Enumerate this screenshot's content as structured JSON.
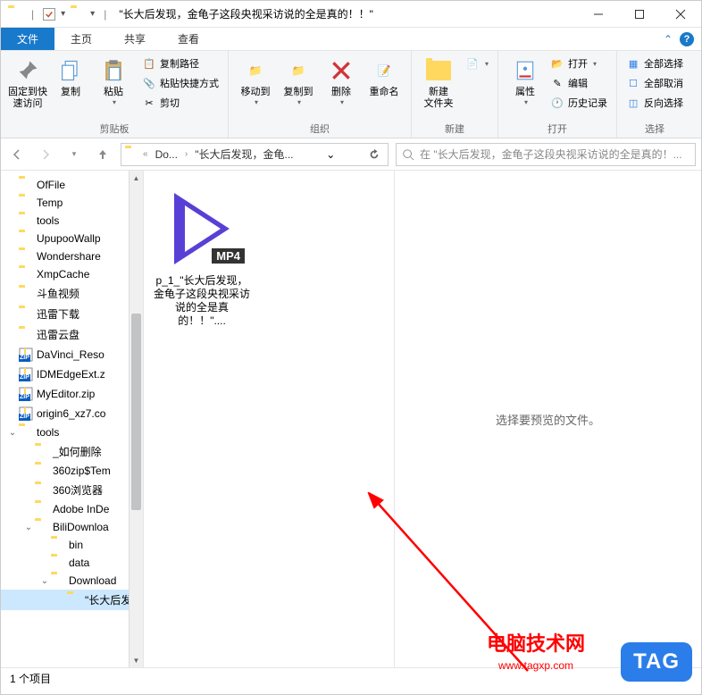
{
  "title": "\"长大后发现，金龟子这段央视采访说的全是真的！！\"",
  "tabs": {
    "file": "文件",
    "home": "主页",
    "share": "共享",
    "view": "查看"
  },
  "ribbon": {
    "pin": "固定到快\n速访问",
    "copy": "复制",
    "paste": "粘贴",
    "copyPath": "复制路径",
    "pasteShortcut": "粘贴快捷方式",
    "cut": "剪切",
    "clipboard": "剪贴板",
    "moveTo": "移动到",
    "copyTo": "复制到",
    "delete": "删除",
    "rename": "重命名",
    "organize": "组织",
    "newFolder": "新建\n文件夹",
    "new": "新建",
    "properties": "属性",
    "openBtn": "打开",
    "edit": "编辑",
    "history": "历史记录",
    "openGroup": "打开",
    "selectAll": "全部选择",
    "selectNone": "全部取消",
    "invertSel": "反向选择",
    "select": "选择"
  },
  "breadcrumb": {
    "seg1": "Do...",
    "seg2": "\"长大后发现，金龟..."
  },
  "search": "在 \"长大后发现，金龟子这段央视采访说的全是真的！...",
  "tree": [
    {
      "name": "OfFile",
      "type": "folder"
    },
    {
      "name": "Temp",
      "type": "folder"
    },
    {
      "name": "tools",
      "type": "folder"
    },
    {
      "name": "UpupooWallp",
      "type": "folder"
    },
    {
      "name": "Wondershare",
      "type": "folder"
    },
    {
      "name": "XmpCache",
      "type": "folder"
    },
    {
      "name": "斗鱼视频",
      "type": "folder"
    },
    {
      "name": "迅雷下载",
      "type": "folder"
    },
    {
      "name": "迅雷云盘",
      "type": "folder"
    },
    {
      "name": "DaVinci_Reso",
      "type": "zip"
    },
    {
      "name": "IDMEdgeExt.z",
      "type": "zip"
    },
    {
      "name": "MyEditor.zip",
      "type": "zip"
    },
    {
      "name": "origin6_xz7.co",
      "type": "zip"
    },
    {
      "name": "tools",
      "type": "folder",
      "expanded": true,
      "children": [
        {
          "name": "_如何删除",
          "type": "folder"
        },
        {
          "name": "360zip$Tem",
          "type": "folder"
        },
        {
          "name": "360浏览器",
          "type": "folder"
        },
        {
          "name": "Adobe InDe",
          "type": "folder"
        },
        {
          "name": "BiliDownloa",
          "type": "folder",
          "expanded": true,
          "children": [
            {
              "name": "bin",
              "type": "folder"
            },
            {
              "name": "data",
              "type": "folder"
            },
            {
              "name": "Download",
              "type": "folder",
              "expanded": true,
              "children": [
                {
                  "name": "\"长大后发",
                  "type": "folder",
                  "selected": true
                }
              ]
            }
          ]
        }
      ]
    }
  ],
  "file": {
    "badge": "MP4",
    "name": "p_1_\"长大后发现，金龟子这段央视采访说的全是真的！！\"...."
  },
  "preview": "选择要预览的文件。",
  "status": "1 个项目",
  "watermark": {
    "title": "电脑技术网",
    "url": "www.tagxp.com",
    "tag": "TAG"
  }
}
